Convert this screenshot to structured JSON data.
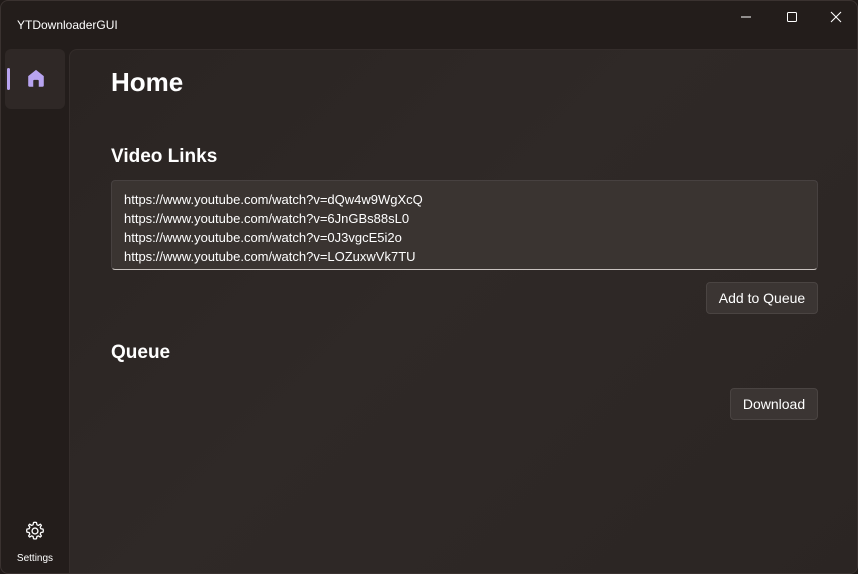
{
  "window": {
    "title": "YTDownloaderGUI"
  },
  "nav": {
    "home_icon": "home-icon",
    "settings_icon": "gear-icon",
    "settings_label": "Settings",
    "accent_color": "#b8a4f0"
  },
  "main": {
    "page_title": "Home",
    "video_links": {
      "heading": "Video Links",
      "lines": [
        "https://www.youtube.com/watch?v=dQw4w9WgXcQ",
        "https://www.youtube.com/watch?v=6JnGBs88sL0",
        "https://www.youtube.com/watch?v=0J3vgcE5i2o",
        "https://www.youtube.com/watch?v=LOZuxwVk7TU"
      ],
      "add_button": "Add to Queue"
    },
    "queue": {
      "heading": "Queue",
      "download_button": "Download"
    }
  }
}
